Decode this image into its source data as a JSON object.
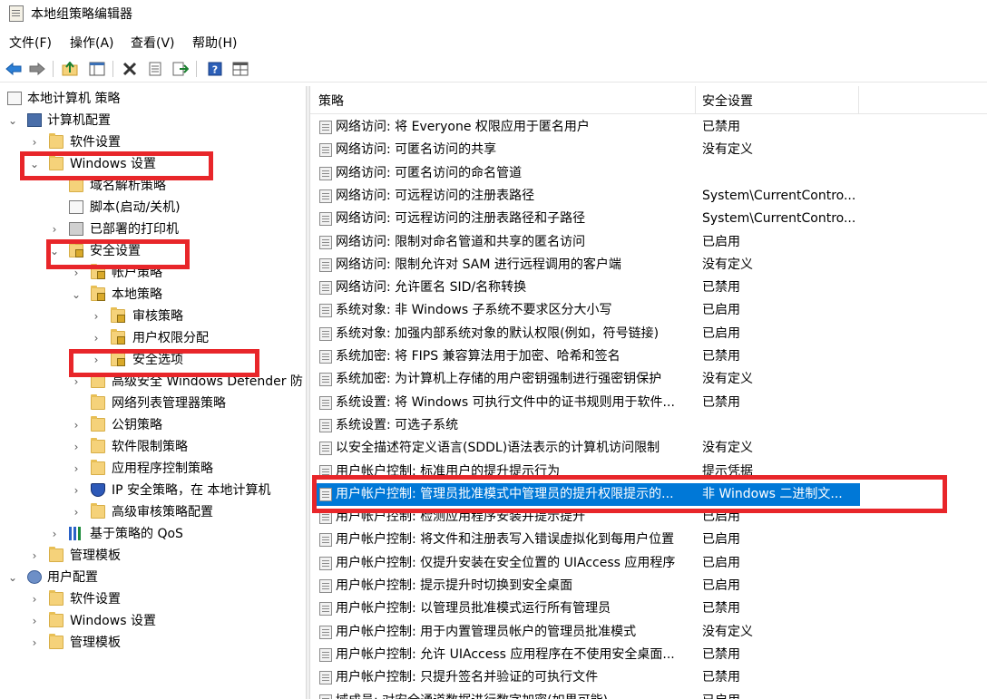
{
  "window": {
    "title": "本地组策略编辑器"
  },
  "menu": [
    {
      "label": "文件(F)"
    },
    {
      "label": "操作(A)"
    },
    {
      "label": "查看(V)"
    },
    {
      "label": "帮助(H)"
    }
  ],
  "toolbar": {
    "buttons": [
      "back-icon",
      "forward-icon",
      "up-folder-icon",
      "show-hide-tree-icon",
      "delete-icon",
      "properties-icon",
      "export-list-icon",
      "help-icon",
      "console-view-icon"
    ]
  },
  "tree": {
    "items": [
      {
        "label": "本地计算机 策略",
        "arrow": "",
        "icon": "doc"
      },
      {
        "label": "计算机配置",
        "arrow": "⌄",
        "icon": "computer"
      },
      {
        "label": "软件设置",
        "arrow": "›",
        "icon": "folder"
      },
      {
        "label": "Windows 设置",
        "arrow": "⌄",
        "icon": "folder"
      },
      {
        "label": "域名解析策略",
        "arrow": "",
        "icon": "folder"
      },
      {
        "label": "脚本(启动/关机)",
        "arrow": "",
        "icon": "doc"
      },
      {
        "label": "已部署的打印机",
        "arrow": "›",
        "icon": "printer"
      },
      {
        "label": "安全设置",
        "arrow": "⌄",
        "icon": "lockfolder"
      },
      {
        "label": "帐户策略",
        "arrow": "›",
        "icon": "lockfolder"
      },
      {
        "label": "本地策略",
        "arrow": "⌄",
        "icon": "lockfolder"
      },
      {
        "label": "审核策略",
        "arrow": "›",
        "icon": "lockfolder"
      },
      {
        "label": "用户权限分配",
        "arrow": "›",
        "icon": "lockfolder"
      },
      {
        "label": "安全选项",
        "arrow": "›",
        "icon": "lockfolder"
      },
      {
        "label": "高级安全 Windows Defender 防",
        "arrow": "›",
        "icon": "folder"
      },
      {
        "label": "网络列表管理器策略",
        "arrow": "",
        "icon": "folder"
      },
      {
        "label": "公钥策略",
        "arrow": "›",
        "icon": "folder"
      },
      {
        "label": "软件限制策略",
        "arrow": "›",
        "icon": "folder"
      },
      {
        "label": "应用程序控制策略",
        "arrow": "›",
        "icon": "folder"
      },
      {
        "label": "IP 安全策略，在 本地计算机",
        "arrow": "›",
        "icon": "shield"
      },
      {
        "label": "高级审核策略配置",
        "arrow": "›",
        "icon": "folder"
      },
      {
        "label": "基于策略的 QoS",
        "arrow": "›",
        "icon": "chart"
      },
      {
        "label": "管理模板",
        "arrow": "›",
        "icon": "folder"
      },
      {
        "label": "用户配置",
        "arrow": "⌄",
        "icon": "user"
      },
      {
        "label": "软件设置",
        "arrow": "›",
        "icon": "folder"
      },
      {
        "label": "Windows 设置",
        "arrow": "›",
        "icon": "folder"
      },
      {
        "label": "管理模板",
        "arrow": "›",
        "icon": "folder"
      }
    ]
  },
  "list": {
    "headers": {
      "policy": "策略",
      "setting": "安全设置",
      "sort_caret": "^"
    },
    "rows": [
      {
        "policy": "网络访问: 将 Everyone 权限应用于匿名用户",
        "setting": "已禁用"
      },
      {
        "policy": "网络访问: 可匿名访问的共享",
        "setting": "没有定义"
      },
      {
        "policy": "网络访问: 可匿名访问的命名管道",
        "setting": ""
      },
      {
        "policy": "网络访问: 可远程访问的注册表路径",
        "setting": "System\\CurrentContro..."
      },
      {
        "policy": "网络访问: 可远程访问的注册表路径和子路径",
        "setting": "System\\CurrentContro..."
      },
      {
        "policy": "网络访问: 限制对命名管道和共享的匿名访问",
        "setting": "已启用"
      },
      {
        "policy": "网络访问: 限制允许对 SAM 进行远程调用的客户端",
        "setting": "没有定义"
      },
      {
        "policy": "网络访问: 允许匿名 SID/名称转换",
        "setting": "已禁用"
      },
      {
        "policy": "系统对象: 非 Windows 子系统不要求区分大小写",
        "setting": "已启用"
      },
      {
        "policy": "系统对象: 加强内部系统对象的默认权限(例如，符号链接)",
        "setting": "已启用"
      },
      {
        "policy": "系统加密: 将 FIPS 兼容算法用于加密、哈希和签名",
        "setting": "已禁用"
      },
      {
        "policy": "系统加密: 为计算机上存储的用户密钥强制进行强密钥保护",
        "setting": "没有定义"
      },
      {
        "policy": "系统设置: 将 Windows 可执行文件中的证书规则用于软件...",
        "setting": "已禁用"
      },
      {
        "policy": "系统设置: 可选子系统",
        "setting": ""
      },
      {
        "policy": "以安全描述符定义语言(SDDL)语法表示的计算机访问限制",
        "setting": "没有定义"
      },
      {
        "policy": "用户帐户控制: 标准用户的提升提示行为",
        "setting": "提示凭据"
      },
      {
        "policy": "用户帐户控制: 管理员批准模式中管理员的提升权限提示的...",
        "setting": "非 Windows 二进制文..."
      },
      {
        "policy": "用户帐户控制: 检测应用程序安装并提示提升",
        "setting": "已启用"
      },
      {
        "policy": "用户帐户控制: 将文件和注册表写入错误虚拟化到每用户位置",
        "setting": "已启用"
      },
      {
        "policy": "用户帐户控制: 仅提升安装在安全位置的 UIAccess 应用程序",
        "setting": "已启用"
      },
      {
        "policy": "用户帐户控制: 提示提升时切换到安全桌面",
        "setting": "已启用"
      },
      {
        "policy": "用户帐户控制: 以管理员批准模式运行所有管理员",
        "setting": "已禁用"
      },
      {
        "policy": "用户帐户控制: 用于内置管理员帐户的管理员批准模式",
        "setting": "没有定义"
      },
      {
        "policy": "用户帐户控制: 允许 UIAccess 应用程序在不使用安全桌面...",
        "setting": "已禁用"
      },
      {
        "policy": "用户帐户控制: 只提升签名并验证的可执行文件",
        "setting": "已禁用"
      },
      {
        "policy": "域成员: 对安全通道数据进行数字加密(如果可能)",
        "setting": "已启用"
      }
    ],
    "selected_row": 16
  },
  "colors": {
    "selection": "#0078d7",
    "annotation": "#e8262a"
  }
}
